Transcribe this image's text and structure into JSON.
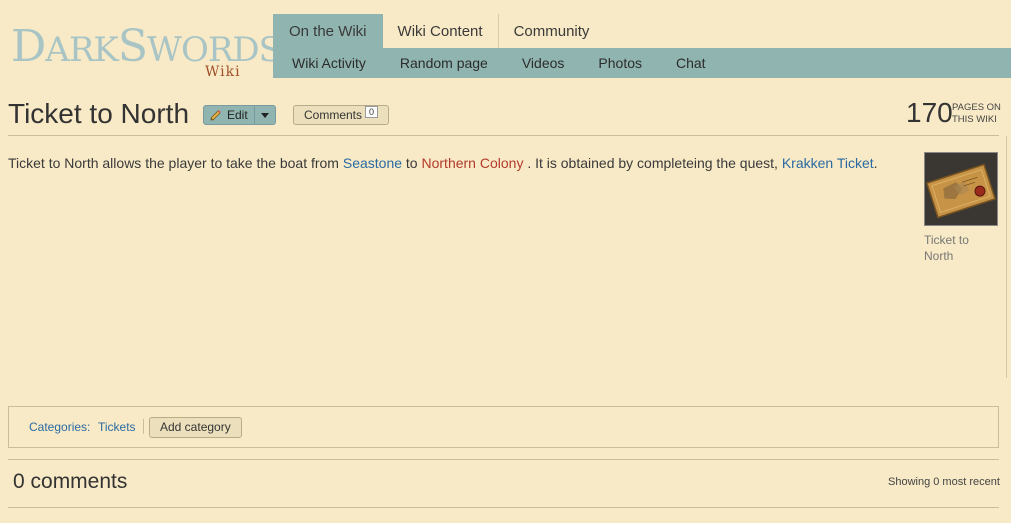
{
  "logo": {
    "main_big1": "D",
    "main_small1": "ARK",
    "main_big2": "S",
    "main_small2": "WORDS",
    "sub": "Wiki"
  },
  "tabs": [
    {
      "label": "On the Wiki",
      "active": true
    },
    {
      "label": "Wiki Content",
      "active": false
    },
    {
      "label": "Community",
      "active": false
    }
  ],
  "subnav": [
    "Wiki Activity",
    "Random page",
    "Videos",
    "Photos",
    "Chat"
  ],
  "page": {
    "title": "Ticket to North",
    "edit_label": "Edit",
    "comments_label": "Comments",
    "comments_count": "0",
    "pages_count": "170",
    "pages_label_1": "PAGES ON",
    "pages_label_2": "THIS WIKI"
  },
  "article": {
    "text_1": "Ticket to North allows the player to take the boat from ",
    "link_seastone": "Seastone",
    "text_2": " to ",
    "link_northern": "Northern Colony",
    "text_3": " . It is obtained by completeing the quest, ",
    "link_quest": "Krakken Ticket",
    "text_4": ".",
    "image_caption": "Ticket to North"
  },
  "categories": {
    "label": "Categories:",
    "items": [
      "Tickets"
    ],
    "add_label": "Add category"
  },
  "comments": {
    "heading": "0 comments",
    "showing": "Showing 0 most recent"
  },
  "colors": {
    "background": "#f8eac6",
    "nav": "#90b4af",
    "link": "#2a6aa2",
    "redlink": "#b33a2b"
  }
}
